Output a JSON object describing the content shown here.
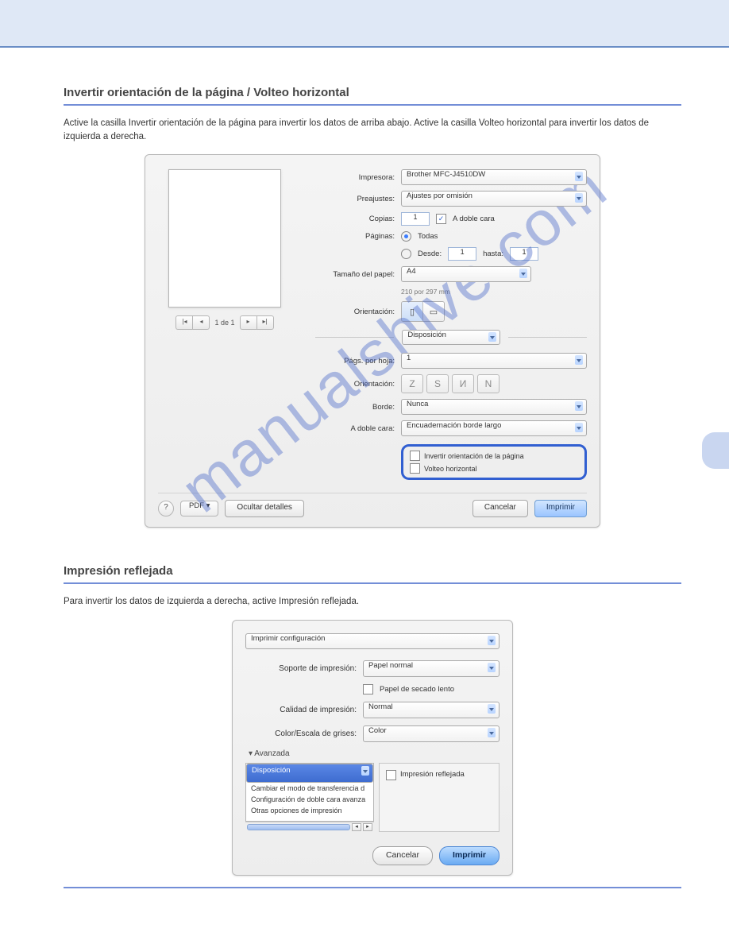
{
  "watermark": "manualshive.com",
  "section1": {
    "heading": "Invertir orientación de la página / Volteo horizontal",
    "para": "Active la casilla Invertir orientación de la página para invertir los datos de arriba abajo. Active la casilla Volteo horizontal para invertir los datos de izquierda a derecha."
  },
  "section2": {
    "heading": "Impresión reflejada",
    "para": "Para invertir los datos de izquierda a derecha, active Impresión reflejada."
  },
  "dialog1": {
    "labels": {
      "impresora": "Impresora:",
      "preajustes": "Preajustes:",
      "copias": "Copias:",
      "a_doble_cara_chk": "A doble cara",
      "paginas": "Páginas:",
      "todas": "Todas",
      "desde": "Desde:",
      "hasta": "hasta:",
      "tamano": "Tamaño del papel:",
      "tamano_sub": "210 por 297 mm",
      "orientacion": "Orientación:",
      "section_select": "Disposición",
      "pags_hoja": "Págs. por hoja:",
      "orientacion2": "Orientación:",
      "borde": "Borde:",
      "doble_cara": "A doble cara:",
      "invertir": "Invertir orientación de la página",
      "volteo": "Volteo horizontal",
      "pdf": "PDF ▾",
      "ocultar": "Ocultar detalles",
      "cancelar": "Cancelar",
      "imprimir": "Imprimir"
    },
    "values": {
      "impresora": "Brother MFC-J4510DW",
      "preajustes": "Ajustes por omisión",
      "copias": "1",
      "desde": "1",
      "hasta": "1",
      "tamano": "A4",
      "pags_hoja": "1",
      "borde": "Nunca",
      "doble_cara": "Encuadernación borde largo",
      "pager": "1 de 1"
    }
  },
  "dialog2": {
    "top_select": "Imprimir configuración",
    "labels": {
      "soporte": "Soporte de impresión:",
      "secado": "Papel de secado lento",
      "calidad": "Calidad de impresión:",
      "color": "Color/Escala de grises:",
      "avanzada": "Avanzada",
      "reflejada": "Impresión reflejada",
      "cancelar": "Cancelar",
      "imprimir": "Imprimir"
    },
    "values": {
      "soporte": "Papel normal",
      "calidad": "Normal",
      "color": "Color"
    },
    "list": {
      "i0": "Disposición",
      "i1": "Cambiar el modo de transferencia d",
      "i2": "Configuración de doble cara avanza",
      "i3": "Otras opciones de impresión"
    }
  }
}
